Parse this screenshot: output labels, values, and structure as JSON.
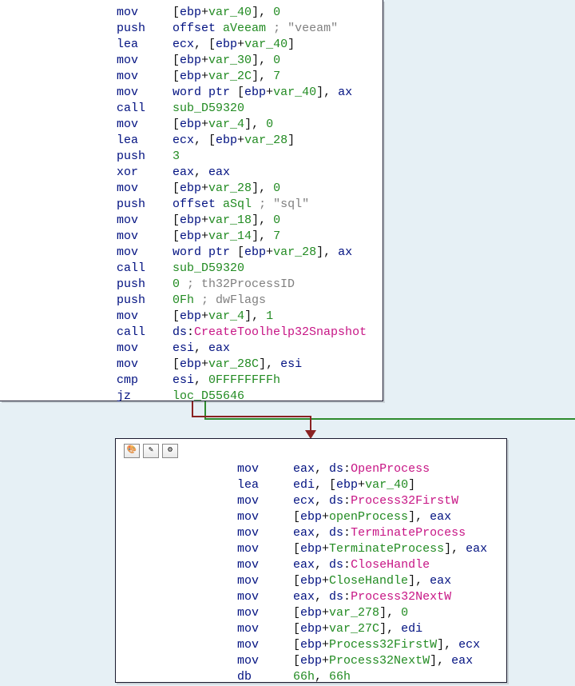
{
  "block1": {
    "lines": [
      {
        "mn": "mov",
        "ops": [
          {
            "t": "txt",
            "v": "["
          },
          {
            "t": "reg",
            "v": "ebp"
          },
          {
            "t": "txt",
            "v": "+"
          },
          {
            "t": "lbl",
            "v": "var_40"
          },
          {
            "t": "txt",
            "v": "], "
          },
          {
            "t": "num",
            "v": "0"
          }
        ]
      },
      {
        "mn": "push",
        "ops": [
          {
            "t": "reg",
            "v": "offset"
          },
          {
            "t": "txt",
            "v": " "
          },
          {
            "t": "lbl",
            "v": "aVeeam"
          },
          {
            "t": "txt",
            "v": " "
          },
          {
            "t": "cmt",
            "v": "; \"veeam\""
          }
        ]
      },
      {
        "mn": "lea",
        "ops": [
          {
            "t": "reg",
            "v": "ecx"
          },
          {
            "t": "txt",
            "v": ", ["
          },
          {
            "t": "reg",
            "v": "ebp"
          },
          {
            "t": "txt",
            "v": "+"
          },
          {
            "t": "lbl",
            "v": "var_40"
          },
          {
            "t": "txt",
            "v": "]"
          }
        ]
      },
      {
        "mn": "mov",
        "ops": [
          {
            "t": "txt",
            "v": "["
          },
          {
            "t": "reg",
            "v": "ebp"
          },
          {
            "t": "txt",
            "v": "+"
          },
          {
            "t": "lbl",
            "v": "var_30"
          },
          {
            "t": "txt",
            "v": "], "
          },
          {
            "t": "num",
            "v": "0"
          }
        ]
      },
      {
        "mn": "mov",
        "ops": [
          {
            "t": "txt",
            "v": "["
          },
          {
            "t": "reg",
            "v": "ebp"
          },
          {
            "t": "txt",
            "v": "+"
          },
          {
            "t": "lbl",
            "v": "var_2C"
          },
          {
            "t": "txt",
            "v": "], "
          },
          {
            "t": "num",
            "v": "7"
          }
        ]
      },
      {
        "mn": "mov",
        "ops": [
          {
            "t": "reg",
            "v": "word ptr"
          },
          {
            "t": "txt",
            "v": " ["
          },
          {
            "t": "reg",
            "v": "ebp"
          },
          {
            "t": "txt",
            "v": "+"
          },
          {
            "t": "lbl",
            "v": "var_40"
          },
          {
            "t": "txt",
            "v": "], "
          },
          {
            "t": "reg",
            "v": "ax"
          }
        ]
      },
      {
        "mn": "call",
        "ops": [
          {
            "t": "lbl",
            "v": "sub_D59320"
          }
        ]
      },
      {
        "mn": "mov",
        "ops": [
          {
            "t": "txt",
            "v": "["
          },
          {
            "t": "reg",
            "v": "ebp"
          },
          {
            "t": "txt",
            "v": "+"
          },
          {
            "t": "lbl",
            "v": "var_4"
          },
          {
            "t": "txt",
            "v": "], "
          },
          {
            "t": "num",
            "v": "0"
          }
        ]
      },
      {
        "mn": "lea",
        "ops": [
          {
            "t": "reg",
            "v": "ecx"
          },
          {
            "t": "txt",
            "v": ", ["
          },
          {
            "t": "reg",
            "v": "ebp"
          },
          {
            "t": "txt",
            "v": "+"
          },
          {
            "t": "lbl",
            "v": "var_28"
          },
          {
            "t": "txt",
            "v": "]"
          }
        ]
      },
      {
        "mn": "push",
        "ops": [
          {
            "t": "num",
            "v": "3"
          }
        ]
      },
      {
        "mn": "xor",
        "ops": [
          {
            "t": "reg",
            "v": "eax"
          },
          {
            "t": "txt",
            "v": ", "
          },
          {
            "t": "reg",
            "v": "eax"
          }
        ]
      },
      {
        "mn": "mov",
        "ops": [
          {
            "t": "txt",
            "v": "["
          },
          {
            "t": "reg",
            "v": "ebp"
          },
          {
            "t": "txt",
            "v": "+"
          },
          {
            "t": "lbl",
            "v": "var_28"
          },
          {
            "t": "txt",
            "v": "], "
          },
          {
            "t": "num",
            "v": "0"
          }
        ]
      },
      {
        "mn": "push",
        "ops": [
          {
            "t": "reg",
            "v": "offset"
          },
          {
            "t": "txt",
            "v": " "
          },
          {
            "t": "lbl",
            "v": "aSql"
          },
          {
            "t": "txt",
            "v": " "
          },
          {
            "t": "cmt",
            "v": "; \"sql\""
          }
        ]
      },
      {
        "mn": "mov",
        "ops": [
          {
            "t": "txt",
            "v": "["
          },
          {
            "t": "reg",
            "v": "ebp"
          },
          {
            "t": "txt",
            "v": "+"
          },
          {
            "t": "lbl",
            "v": "var_18"
          },
          {
            "t": "txt",
            "v": "], "
          },
          {
            "t": "num",
            "v": "0"
          }
        ]
      },
      {
        "mn": "mov",
        "ops": [
          {
            "t": "txt",
            "v": "["
          },
          {
            "t": "reg",
            "v": "ebp"
          },
          {
            "t": "txt",
            "v": "+"
          },
          {
            "t": "lbl",
            "v": "var_14"
          },
          {
            "t": "txt",
            "v": "], "
          },
          {
            "t": "num",
            "v": "7"
          }
        ]
      },
      {
        "mn": "mov",
        "ops": [
          {
            "t": "reg",
            "v": "word ptr"
          },
          {
            "t": "txt",
            "v": " ["
          },
          {
            "t": "reg",
            "v": "ebp"
          },
          {
            "t": "txt",
            "v": "+"
          },
          {
            "t": "lbl",
            "v": "var_28"
          },
          {
            "t": "txt",
            "v": "], "
          },
          {
            "t": "reg",
            "v": "ax"
          }
        ]
      },
      {
        "mn": "call",
        "ops": [
          {
            "t": "lbl",
            "v": "sub_D59320"
          }
        ]
      },
      {
        "mn": "push",
        "ops": [
          {
            "t": "num",
            "v": "0"
          },
          {
            "t": "txt",
            "v": " "
          },
          {
            "t": "cmt",
            "v": "; th32ProcessID"
          }
        ]
      },
      {
        "mn": "push",
        "ops": [
          {
            "t": "num",
            "v": "0Fh"
          },
          {
            "t": "txt",
            "v": " "
          },
          {
            "t": "cmt",
            "v": "; dwFlags"
          }
        ]
      },
      {
        "mn": "mov",
        "ops": [
          {
            "t": "txt",
            "v": "["
          },
          {
            "t": "reg",
            "v": "ebp"
          },
          {
            "t": "txt",
            "v": "+"
          },
          {
            "t": "lbl",
            "v": "var_4"
          },
          {
            "t": "txt",
            "v": "], "
          },
          {
            "t": "num",
            "v": "1"
          }
        ]
      },
      {
        "mn": "call",
        "ops": [
          {
            "t": "reg",
            "v": "ds"
          },
          {
            "t": "txt",
            "v": ":"
          },
          {
            "t": "api",
            "v": "CreateToolhelp32Snapshot"
          }
        ]
      },
      {
        "mn": "mov",
        "ops": [
          {
            "t": "reg",
            "v": "esi"
          },
          {
            "t": "txt",
            "v": ", "
          },
          {
            "t": "reg",
            "v": "eax"
          }
        ]
      },
      {
        "mn": "mov",
        "ops": [
          {
            "t": "txt",
            "v": "["
          },
          {
            "t": "reg",
            "v": "ebp"
          },
          {
            "t": "txt",
            "v": "+"
          },
          {
            "t": "lbl",
            "v": "var_28C"
          },
          {
            "t": "txt",
            "v": "], "
          },
          {
            "t": "reg",
            "v": "esi"
          }
        ]
      },
      {
        "mn": "cmp",
        "ops": [
          {
            "t": "reg",
            "v": "esi"
          },
          {
            "t": "txt",
            "v": ", "
          },
          {
            "t": "num",
            "v": "0FFFFFFFFh"
          }
        ]
      },
      {
        "mn": "jz",
        "ops": [
          {
            "t": "lbl",
            "v": "loc_D55646"
          }
        ]
      }
    ]
  },
  "block2": {
    "lines": [
      {
        "mn": "mov",
        "ops": [
          {
            "t": "reg",
            "v": "eax"
          },
          {
            "t": "txt",
            "v": ", "
          },
          {
            "t": "reg",
            "v": "ds"
          },
          {
            "t": "txt",
            "v": ":"
          },
          {
            "t": "api",
            "v": "OpenProcess"
          }
        ]
      },
      {
        "mn": "lea",
        "ops": [
          {
            "t": "reg",
            "v": "edi"
          },
          {
            "t": "txt",
            "v": ", ["
          },
          {
            "t": "reg",
            "v": "ebp"
          },
          {
            "t": "txt",
            "v": "+"
          },
          {
            "t": "lbl",
            "v": "var_40"
          },
          {
            "t": "txt",
            "v": "]"
          }
        ]
      },
      {
        "mn": "mov",
        "ops": [
          {
            "t": "reg",
            "v": "ecx"
          },
          {
            "t": "txt",
            "v": ", "
          },
          {
            "t": "reg",
            "v": "ds"
          },
          {
            "t": "txt",
            "v": ":"
          },
          {
            "t": "api",
            "v": "Process32FirstW"
          }
        ]
      },
      {
        "mn": "mov",
        "ops": [
          {
            "t": "txt",
            "v": "["
          },
          {
            "t": "reg",
            "v": "ebp"
          },
          {
            "t": "txt",
            "v": "+"
          },
          {
            "t": "lbl",
            "v": "openProcess"
          },
          {
            "t": "txt",
            "v": "], "
          },
          {
            "t": "reg",
            "v": "eax"
          }
        ]
      },
      {
        "mn": "mov",
        "ops": [
          {
            "t": "reg",
            "v": "eax"
          },
          {
            "t": "txt",
            "v": ", "
          },
          {
            "t": "reg",
            "v": "ds"
          },
          {
            "t": "txt",
            "v": ":"
          },
          {
            "t": "api",
            "v": "TerminateProcess"
          }
        ]
      },
      {
        "mn": "mov",
        "ops": [
          {
            "t": "txt",
            "v": "["
          },
          {
            "t": "reg",
            "v": "ebp"
          },
          {
            "t": "txt",
            "v": "+"
          },
          {
            "t": "lbl",
            "v": "TerminateProcess"
          },
          {
            "t": "txt",
            "v": "], "
          },
          {
            "t": "reg",
            "v": "eax"
          }
        ]
      },
      {
        "mn": "mov",
        "ops": [
          {
            "t": "reg",
            "v": "eax"
          },
          {
            "t": "txt",
            "v": ", "
          },
          {
            "t": "reg",
            "v": "ds"
          },
          {
            "t": "txt",
            "v": ":"
          },
          {
            "t": "api",
            "v": "CloseHandle"
          }
        ]
      },
      {
        "mn": "mov",
        "ops": [
          {
            "t": "txt",
            "v": "["
          },
          {
            "t": "reg",
            "v": "ebp"
          },
          {
            "t": "txt",
            "v": "+"
          },
          {
            "t": "lbl",
            "v": "CloseHandle"
          },
          {
            "t": "txt",
            "v": "], "
          },
          {
            "t": "reg",
            "v": "eax"
          }
        ]
      },
      {
        "mn": "mov",
        "ops": [
          {
            "t": "reg",
            "v": "eax"
          },
          {
            "t": "txt",
            "v": ", "
          },
          {
            "t": "reg",
            "v": "ds"
          },
          {
            "t": "txt",
            "v": ":"
          },
          {
            "t": "api",
            "v": "Process32NextW"
          }
        ]
      },
      {
        "mn": "mov",
        "ops": [
          {
            "t": "txt",
            "v": "["
          },
          {
            "t": "reg",
            "v": "ebp"
          },
          {
            "t": "txt",
            "v": "+"
          },
          {
            "t": "lbl",
            "v": "var_278"
          },
          {
            "t": "txt",
            "v": "], "
          },
          {
            "t": "num",
            "v": "0"
          }
        ]
      },
      {
        "mn": "mov",
        "ops": [
          {
            "t": "txt",
            "v": "["
          },
          {
            "t": "reg",
            "v": "ebp"
          },
          {
            "t": "txt",
            "v": "+"
          },
          {
            "t": "lbl",
            "v": "var_27C"
          },
          {
            "t": "txt",
            "v": "], "
          },
          {
            "t": "reg",
            "v": "edi"
          }
        ]
      },
      {
        "mn": "mov",
        "ops": [
          {
            "t": "txt",
            "v": "["
          },
          {
            "t": "reg",
            "v": "ebp"
          },
          {
            "t": "txt",
            "v": "+"
          },
          {
            "t": "lbl",
            "v": "Process32FirstW"
          },
          {
            "t": "txt",
            "v": "], "
          },
          {
            "t": "reg",
            "v": "ecx"
          }
        ]
      },
      {
        "mn": "mov",
        "ops": [
          {
            "t": "txt",
            "v": "["
          },
          {
            "t": "reg",
            "v": "ebp"
          },
          {
            "t": "txt",
            "v": "+"
          },
          {
            "t": "lbl",
            "v": "Process32NextW"
          },
          {
            "t": "txt",
            "v": "], "
          },
          {
            "t": "reg",
            "v": "eax"
          }
        ]
      },
      {
        "mn": "db",
        "ops": [
          {
            "t": "num",
            "v": "66h"
          },
          {
            "t": "txt",
            "v": ", "
          },
          {
            "t": "num",
            "v": "66h"
          }
        ]
      }
    ]
  },
  "toolbar": {
    "btn1": "🎨",
    "btn2": "✎",
    "btn3": "⚙"
  }
}
